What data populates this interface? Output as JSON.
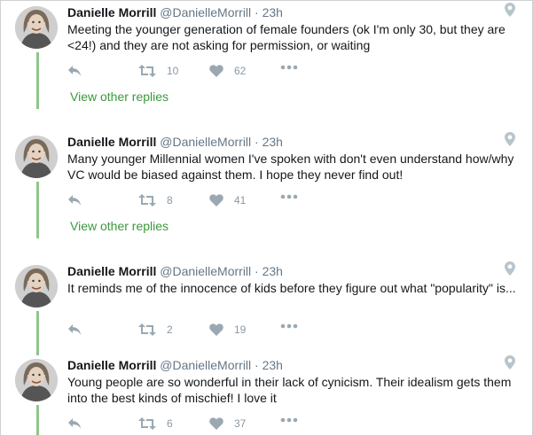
{
  "author": {
    "name": "Danielle Morrill",
    "handle": "@DanielleMorrill"
  },
  "colors": {
    "thread_line": "#8ec58c",
    "link": "#3a9a3a",
    "muted": "#657786"
  },
  "icons": {
    "reply": "reply-icon",
    "retweet": "retweet-icon",
    "like": "heart-icon",
    "more": "more-icon",
    "location": "location-pin-icon"
  },
  "tweets": [
    {
      "time": "23h",
      "text": "Meeting the younger generation of female founders (ok I'm only 30, but they are <24!) and they are not asking for permission, or waiting",
      "retweets": "10",
      "likes": "62",
      "view_replies": "View other replies"
    },
    {
      "time": "23h",
      "text": "Many younger Millennial women I've spoken with don't even understand how/why VC would be biased against them. I hope they never find out!",
      "retweets": "8",
      "likes": "41",
      "view_replies": "View other replies"
    },
    {
      "time": "23h",
      "text": "It reminds me of the innocence of kids before they figure out what \"popularity\" is...",
      "retweets": "2",
      "likes": "19"
    },
    {
      "time": "23h",
      "text": "Young people are so wonderful in their lack of cynicism. Their idealism gets them into the best kinds of mischief! I love it",
      "retweets": "6",
      "likes": "37"
    }
  ]
}
